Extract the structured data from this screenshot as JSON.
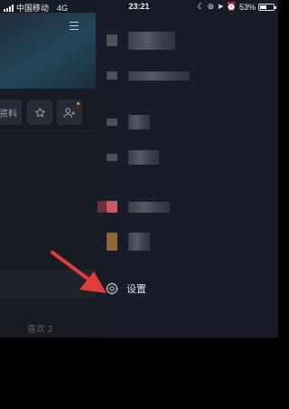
{
  "status_bar": {
    "carrier": "中国移动",
    "network": "4G",
    "time": "23:21",
    "battery_percent": "53%",
    "battery_level": 0.53
  },
  "profile_page": {
    "edit_label": "资料",
    "likes_tab": "喜欢 2"
  },
  "drawer": {
    "items": [
      {
        "icon": "blurred-icon"
      },
      {
        "icon": "blurred-icon"
      },
      {
        "icon": "blurred-icon"
      },
      {
        "icon": "blurred-icon"
      },
      {
        "icon": "blurred-icon"
      },
      {
        "icon": "blurred-icon"
      }
    ],
    "settings": {
      "label": "设置",
      "icon": "gear-icon"
    }
  },
  "annotation": {
    "type": "arrow",
    "color": "#e23b3b",
    "points_to": "settings"
  }
}
